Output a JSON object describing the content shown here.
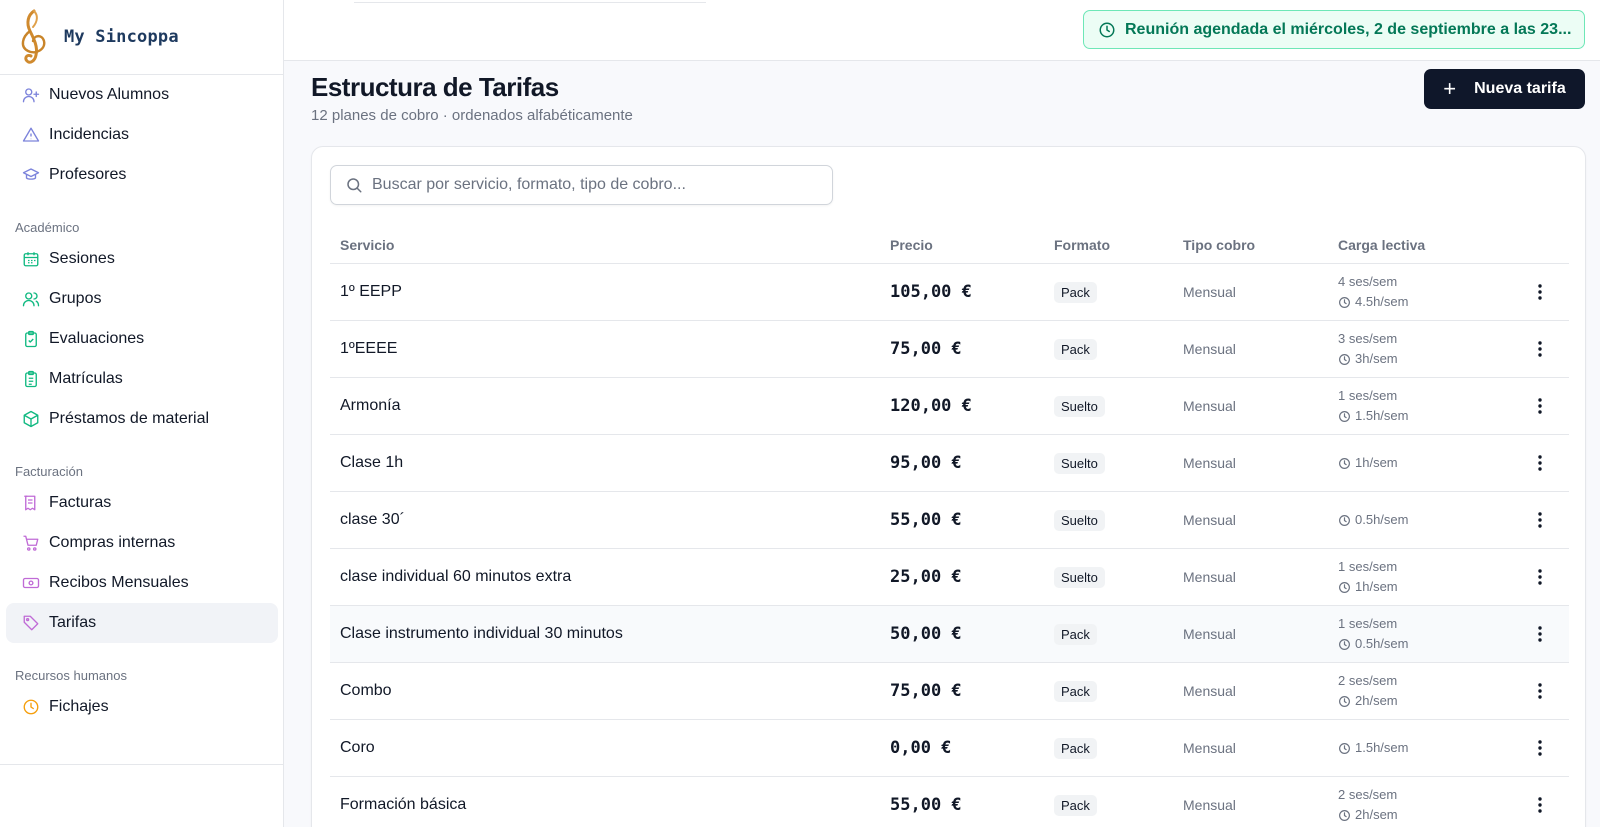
{
  "brand": {
    "name": "My Sincoppa"
  },
  "nav": {
    "top_items": [
      {
        "label": "Nuevos Alumnos",
        "icon": "user-plus-icon"
      },
      {
        "label": "Incidencias",
        "icon": "warning-icon"
      },
      {
        "label": "Profesores",
        "icon": "graduation-cap-icon"
      }
    ],
    "sections": [
      {
        "title": "Académico",
        "items": [
          {
            "label": "Sesiones",
            "icon": "calendar-icon"
          },
          {
            "label": "Grupos",
            "icon": "users-icon"
          },
          {
            "label": "Evaluaciones",
            "icon": "clipboard-check-icon"
          },
          {
            "label": "Matrículas",
            "icon": "clipboard-list-icon"
          },
          {
            "label": "Préstamos de material",
            "icon": "box-icon"
          }
        ]
      },
      {
        "title": "Facturación",
        "items": [
          {
            "label": "Facturas",
            "icon": "receipt-icon"
          },
          {
            "label": "Compras internas",
            "icon": "cart-icon"
          },
          {
            "label": "Recibos Mensuales",
            "icon": "banknote-icon"
          },
          {
            "label": "Tarifas",
            "icon": "tag-icon",
            "active": true
          }
        ]
      },
      {
        "title": "Recursos humanos",
        "items": [
          {
            "label": "Fichajes",
            "icon": "clock-icon"
          }
        ]
      }
    ]
  },
  "notice": {
    "text": "Reunión agendada el miércoles, 2 de septiembre a las 23..."
  },
  "header": {
    "title": "Estructura de Tarifas",
    "subtitle": "12 planes de cobro · ordenados alfabéticamente",
    "new_button": "Nueva tarifa"
  },
  "search": {
    "placeholder": "Buscar por servicio, formato, tipo de cobro..."
  },
  "table": {
    "columns": {
      "servicio": "Servicio",
      "precio": "Precio",
      "formato": "Formato",
      "tipo": "Tipo cobro",
      "carga": "Carga lectiva"
    },
    "rows": [
      {
        "servicio": "1º EEPP",
        "precio": "105,00 €",
        "formato": "Pack",
        "tipo": "Mensual",
        "sesiones": "4 ses/sem",
        "horas": "4.5h/sem"
      },
      {
        "servicio": "1ºEEEE",
        "precio": "75,00 €",
        "formato": "Pack",
        "tipo": "Mensual",
        "sesiones": "3 ses/sem",
        "horas": "3h/sem"
      },
      {
        "servicio": "Armonía",
        "precio": "120,00 €",
        "formato": "Suelto",
        "tipo": "Mensual",
        "sesiones": "1 ses/sem",
        "horas": "1.5h/sem"
      },
      {
        "servicio": "Clase 1h",
        "precio": "95,00 €",
        "formato": "Suelto",
        "tipo": "Mensual",
        "sesiones": "",
        "horas": "1h/sem"
      },
      {
        "servicio": "clase 30´",
        "precio": "55,00 €",
        "formato": "Suelto",
        "tipo": "Mensual",
        "sesiones": "",
        "horas": "0.5h/sem"
      },
      {
        "servicio": "clase individual 60 minutos extra",
        "precio": "25,00 €",
        "formato": "Suelto",
        "tipo": "Mensual",
        "sesiones": "1 ses/sem",
        "horas": "1h/sem"
      },
      {
        "servicio": "Clase instrumento individual 30 minutos",
        "precio": "50,00 €",
        "formato": "Pack",
        "tipo": "Mensual",
        "sesiones": "1 ses/sem",
        "horas": "0.5h/sem",
        "hover": true
      },
      {
        "servicio": "Combo",
        "precio": "75,00 €",
        "formato": "Pack",
        "tipo": "Mensual",
        "sesiones": "2 ses/sem",
        "horas": "2h/sem"
      },
      {
        "servicio": "Coro",
        "precio": "0,00 €",
        "formato": "Pack",
        "tipo": "Mensual",
        "sesiones": "",
        "horas": "1.5h/sem"
      },
      {
        "servicio": "Formación básica",
        "precio": "55,00 €",
        "formato": "Pack",
        "tipo": "Mensual",
        "sesiones": "2 ses/sem",
        "horas": "2h/sem"
      }
    ]
  },
  "colors": {
    "nav_people": "#7c83db",
    "nav_academic": "#10b981",
    "nav_billing": "#c06bd6",
    "nav_hr": "#f59e0b",
    "notice_green": "#047857",
    "primary_dark": "#0f172a"
  }
}
